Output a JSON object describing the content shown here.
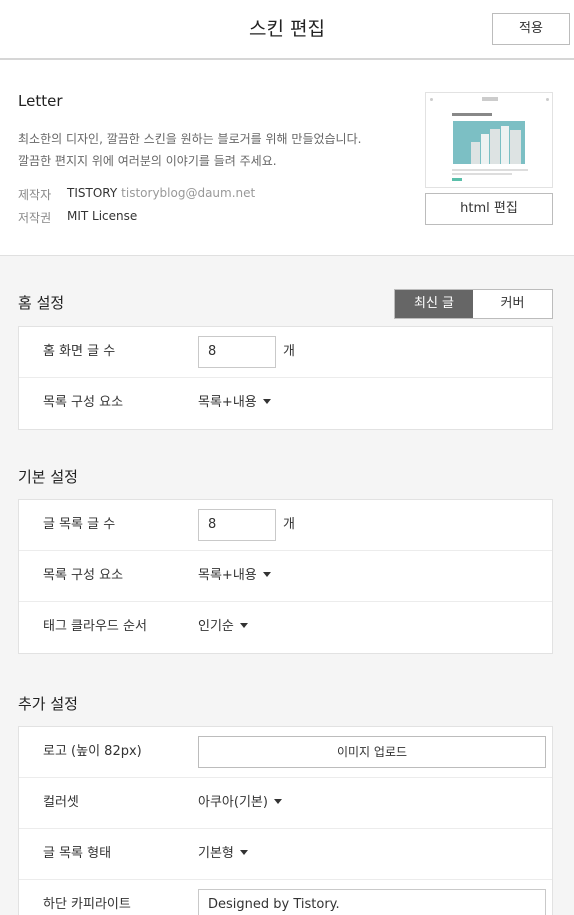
{
  "header": {
    "title": "스킨 편집",
    "apply_label": "적용"
  },
  "skin": {
    "name": "Letter",
    "description_line1": "최소한의 디자인, 깔끔한 스킨을 원하는 블로거를 위해 만들었습니다.",
    "description_line2": "깔끔한 편지지 위에 여러분의 이야기를 들려 주세요.",
    "author_label": "제작자",
    "author_name": "TISTORY",
    "author_email": "tistoryblog@daum.net",
    "license_label": "저작권",
    "license_value": "MIT License",
    "thumbnail_title": "Architecture Issues",
    "html_edit_label": "html 편집"
  },
  "home_settings": {
    "title": "홈 설정",
    "tabs": [
      {
        "label": "최신 글",
        "active": true
      },
      {
        "label": "커버",
        "active": false
      }
    ],
    "rows": [
      {
        "label": "홈 화면 글 수",
        "value": "8",
        "unit": "개"
      },
      {
        "label": "목록 구성 요소",
        "value": "목록+내용"
      }
    ]
  },
  "basic_settings": {
    "title": "기본 설정",
    "rows": [
      {
        "label": "글 목록 글 수",
        "value": "8",
        "unit": "개"
      },
      {
        "label": "목록 구성 요소",
        "value": "목록+내용"
      },
      {
        "label": "태그 클라우드 순서",
        "value": "인기순"
      }
    ]
  },
  "extra_settings": {
    "title": "추가 설정",
    "rows": [
      {
        "label": "로고 (높이 82px)",
        "button_label": "이미지 업로드"
      },
      {
        "label": "컬러셋",
        "value": "아쿠아(기본)"
      },
      {
        "label": "글 목록 형태",
        "value": "기본형"
      },
      {
        "label": "하단 카피라이트",
        "value": "Designed by Tistory."
      }
    ]
  },
  "colors": {
    "active_tab_bg": "#666666",
    "thumb_sky": "#7cbfc4",
    "thumb_button": "#5bbfaa"
  }
}
